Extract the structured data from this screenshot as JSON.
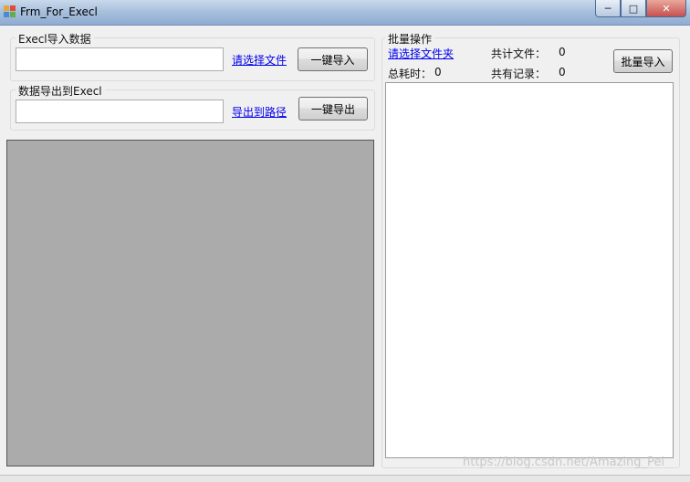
{
  "window": {
    "title": "Frm_For_Execl",
    "controls": {
      "minimize": "─",
      "maximize": "□",
      "close": "✕"
    }
  },
  "import_group": {
    "label": "Execl导入数据",
    "path_value": "",
    "select_link": "请选择文件",
    "button": "一键导入"
  },
  "export_group": {
    "label": "数据导出到Execl",
    "path_value": "",
    "select_link": "导出到路径",
    "button": "一键导出"
  },
  "batch": {
    "label": "批量操作",
    "select_folder_link": "请选择文件夹",
    "total_time_label": "总耗时：",
    "total_time_value": "0",
    "total_files_label": "共计文件：",
    "total_files_value": "0",
    "total_records_label": "共有记录：",
    "total_records_value": "0",
    "button": "批量导入"
  },
  "watermark": "https://blog.csdn.net/Amazing_Pei",
  "colors": {
    "link": "#0000ee",
    "grid_background": "#ababab",
    "form_background": "#f0f0f0"
  }
}
